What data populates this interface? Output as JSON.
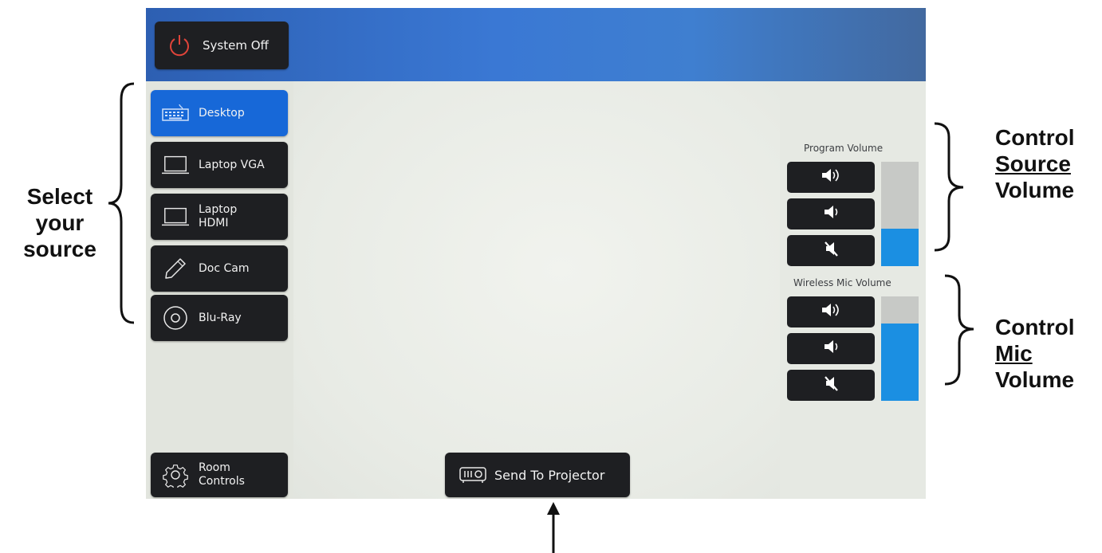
{
  "panel": {
    "system_off": "System Off",
    "sources": [
      {
        "label": "Desktop",
        "icon": "keyboard-icon",
        "active": true
      },
      {
        "label": "Laptop VGA",
        "icon": "laptop-icon",
        "active": false
      },
      {
        "label": "Laptop\nHDMI",
        "icon": "laptop-icon",
        "active": false
      },
      {
        "label": "Doc Cam",
        "icon": "pencil-icon",
        "active": false
      },
      {
        "label": "Blu-Ray",
        "icon": "disc-icon",
        "active": false
      }
    ],
    "room_controls": "Room\nControls",
    "send_to_projector": "Send To Projector",
    "program_volume": {
      "label": "Program Volume",
      "level": 0.36
    },
    "mic_volume": {
      "label": "Wireless Mic Volume",
      "level": 0.74
    }
  },
  "annotations": {
    "select_source": [
      "Select",
      "your",
      "source"
    ],
    "control_source_volume": [
      "Control",
      "Source",
      "Volume"
    ],
    "control_mic_volume": [
      "Control",
      "Mic",
      "Volume"
    ]
  },
  "colors": {
    "active_button": "#1768d8",
    "meter_fill": "#1b8fe2",
    "button_dark": "#1e1f22"
  }
}
